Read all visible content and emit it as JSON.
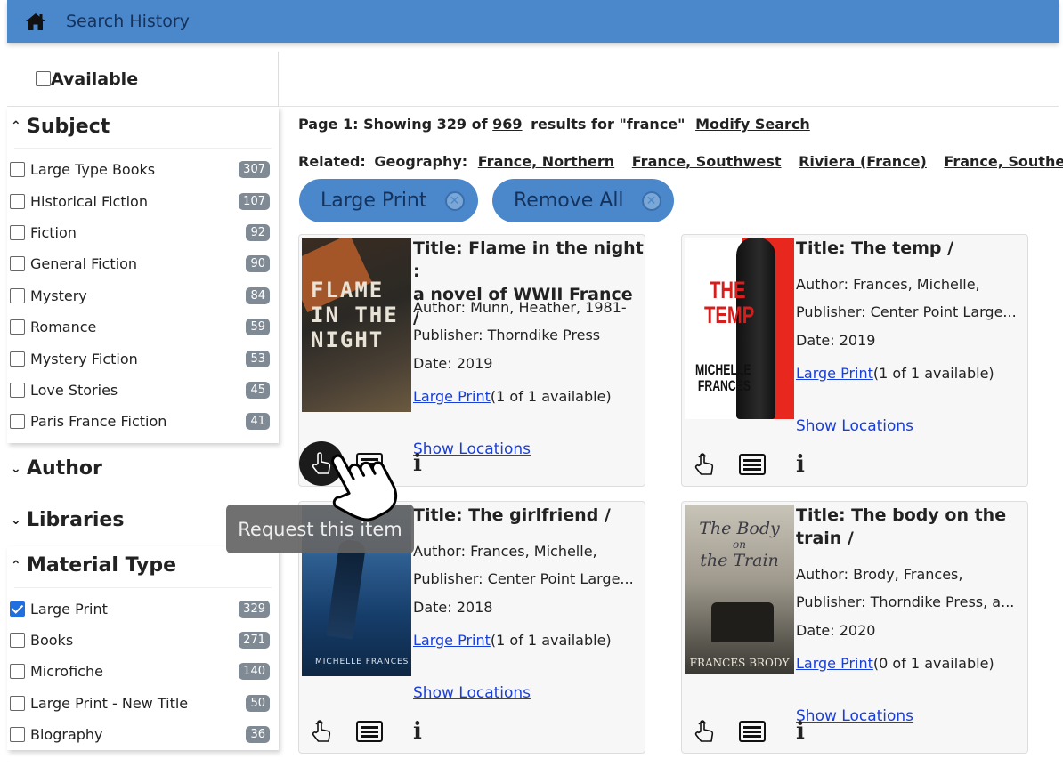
{
  "topbar": {
    "title": "Search History",
    "icon": "home-icon"
  },
  "sidebar": {
    "available_label": "Available",
    "subject": {
      "heading": "Subject",
      "items": [
        {
          "label": "Large Type Books",
          "count": "307"
        },
        {
          "label": "Historical Fiction",
          "count": "107"
        },
        {
          "label": "Fiction",
          "count": "92"
        },
        {
          "label": "General Fiction",
          "count": "90"
        },
        {
          "label": "Mystery",
          "count": "84"
        },
        {
          "label": "Romance",
          "count": "59"
        },
        {
          "label": "Mystery Fiction",
          "count": "53"
        },
        {
          "label": "Love Stories",
          "count": "45"
        },
        {
          "label": "Paris France Fiction",
          "count": "41"
        }
      ]
    },
    "author_heading": "Author",
    "libraries_heading": "Libraries",
    "material": {
      "heading": "Material Type",
      "items": [
        {
          "label": "Large Print",
          "count": "329",
          "checked": true
        },
        {
          "label": "Books",
          "count": "271"
        },
        {
          "label": "Microfiche",
          "count": "140"
        },
        {
          "label": "Large Print - New Title",
          "count": "50"
        },
        {
          "label": "Biography",
          "count": "36"
        }
      ]
    }
  },
  "results": {
    "summary_prefix": "Page 1: Showing 329 of",
    "total": "969",
    "summary_suffix": "results for \"france\"",
    "modify": "Modify Search",
    "related_label": "Related:",
    "geo_label": "Geography:",
    "related_links": [
      "France, Northern",
      "France, Southwest",
      "Riviera (France)",
      "France, Southern"
    ]
  },
  "filters": {
    "large_print": "Large Print",
    "remove_all": "Remove All"
  },
  "cards": [
    {
      "title_1": "Title: Flame in the night :",
      "title_2": "a novel of WWII France /",
      "author": "Author: Munn, Heather, 1981-",
      "publisher": "Publisher: Thorndike Press",
      "date": "Date: 2019",
      "format_link": "Large Print",
      "availability": "(1 of 1 available)",
      "locations": "Show Locations",
      "cover_text": [
        "FLAME",
        "IN THE",
        "NIGHT"
      ]
    },
    {
      "title_1": "Title: The temp /",
      "author": "Author: Frances, Michelle,",
      "publisher": "Publisher: Center Point Large...",
      "date": "Date: 2019",
      "format_link": "Large Print",
      "availability": "(1 of 1 available)",
      "locations": "Show Locations",
      "cover_text": [
        "THE",
        "TEMP",
        "MICHELLE",
        "FRANCES"
      ]
    },
    {
      "title_1": "Title: The girlfriend /",
      "author": "Author: Frances, Michelle,",
      "publisher": "Publisher: Center Point Large...",
      "date": "Date: 2018",
      "format_link": "Large Print",
      "availability": "(1 of 1 available)",
      "locations": "Show Locations",
      "cover_text": [
        "MICHELLE FRANCES"
      ]
    },
    {
      "title_1": "Title: The body on the",
      "title_2": "train /",
      "author": "Author: Brody, Frances,",
      "publisher": "Publisher: Thorndike Press, a...",
      "date": "Date: 2020",
      "format_link": "Large Print",
      "availability": "(0 of 1 available)",
      "locations": "Show Locations",
      "cover_text": [
        "The Body",
        "on",
        "the Train",
        "FRANCES BRODY"
      ]
    }
  ],
  "tooltip": "Request this item",
  "colors": {
    "topbar": "#4a88cb",
    "link": "#1a3fd6",
    "badge": "#7f8a94"
  }
}
